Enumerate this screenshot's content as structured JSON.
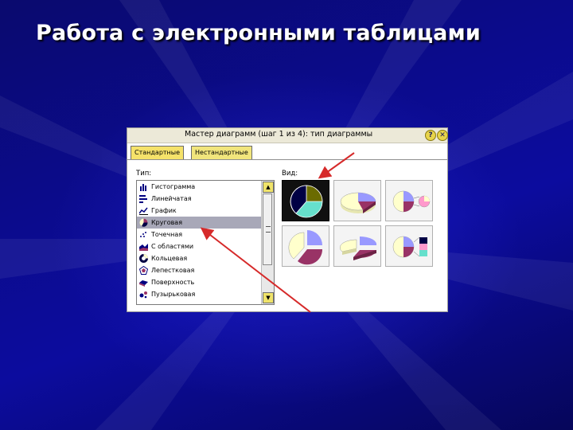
{
  "slide": {
    "title": "Работа с электронными таблицами"
  },
  "dialog": {
    "title": "Мастер диаграмм (шаг 1 из 4): тип диаграммы",
    "help_button": "?",
    "close_button": "✕",
    "tabs": [
      "Стандартные",
      "Нестандартные"
    ],
    "type_label": "Тип:",
    "view_label": "Вид:",
    "chart_types": [
      {
        "label": "Гистограмма",
        "icon": "histogram-icon"
      },
      {
        "label": "Линейчатая",
        "icon": "bar-chart-icon"
      },
      {
        "label": "График",
        "icon": "line-graph-icon"
      },
      {
        "label": "Круговая",
        "icon": "pie-chart-icon"
      },
      {
        "label": "Точечная",
        "icon": "scatter-icon"
      },
      {
        "label": "С областями",
        "icon": "area-chart-icon"
      },
      {
        "label": "Кольцевая",
        "icon": "donut-chart-icon"
      },
      {
        "label": "Лепестковая",
        "icon": "radar-chart-icon"
      },
      {
        "label": "Поверхность",
        "icon": "surface-chart-icon"
      },
      {
        "label": "Пузырьковая",
        "icon": "bubble-chart-icon"
      }
    ],
    "selected_type": "Круговая",
    "scroll_up": "▲",
    "scroll_down": "▼",
    "colors": {
      "pie_olive": "#6b6b00",
      "pie_teal": "#66e0cc",
      "pie_navy": "#000044",
      "pie_cream": "#ffffcc",
      "pie_lavender": "#9999ff",
      "pie_maroon": "#993366",
      "arrow_red": "#d62a2a"
    }
  }
}
